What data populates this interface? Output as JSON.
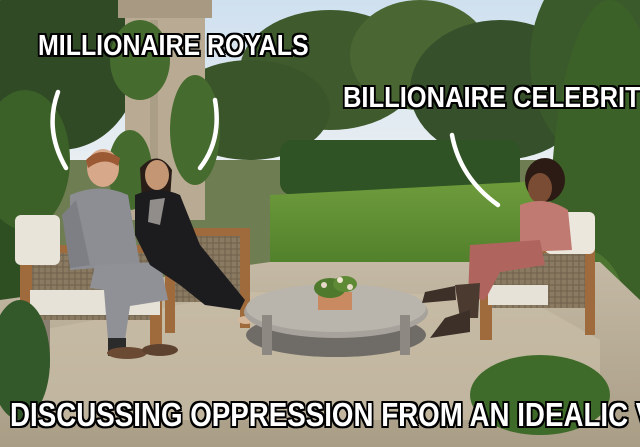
{
  "captions": {
    "left": "MILLIONAIRE ROYALS",
    "right": "BILLIONAIRE CELEBRITY",
    "bottom": "DISCUSSING OPPRESSION FROM AN IDEALIC VILLA"
  },
  "colors": {
    "caption_text": "#ffffff",
    "caption_outline": "#000000",
    "lawn": "#5f8f34",
    "patio": "#b8ad98"
  }
}
